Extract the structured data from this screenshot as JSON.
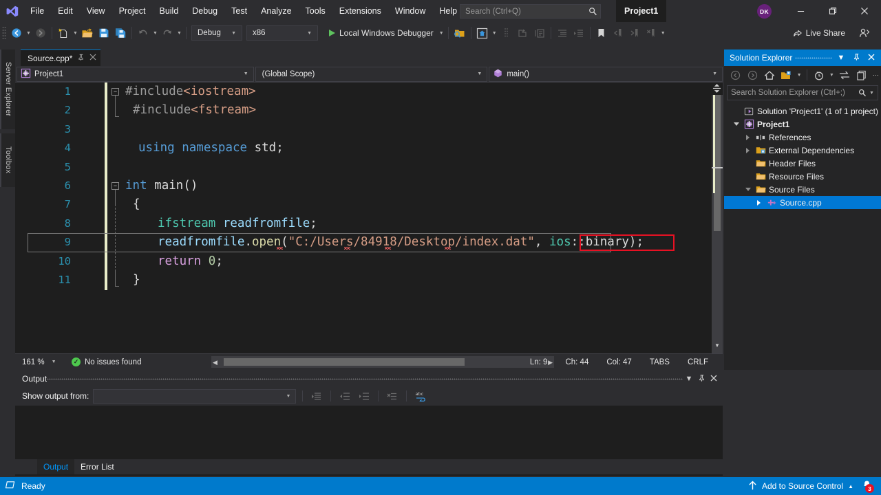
{
  "titlebar": {
    "menu": [
      "File",
      "Edit",
      "View",
      "Project",
      "Build",
      "Debug",
      "Test",
      "Analyze",
      "Tools",
      "Extensions",
      "Window",
      "Help"
    ],
    "search_placeholder": "Search (Ctrl+Q)",
    "search_value": "",
    "project_title": "Project1",
    "avatar_initials": "DK",
    "window_buttons": {
      "minimize": "—",
      "maximize": "❐",
      "close": "✕"
    }
  },
  "toolbar": {
    "config": "Debug",
    "platform": "x86",
    "run_label": "Local Windows Debugger",
    "live_share": "Live Share"
  },
  "vtabs": [
    "Server Explorer",
    "Toolbox"
  ],
  "editor": {
    "tab_label": "Source.cpp*",
    "tab_pin": "‒",
    "tab_close": "✕",
    "nav_project": "Project1",
    "nav_scope": "(Global Scope)",
    "nav_member": "main()",
    "lines": [
      {
        "n": "1",
        "tokens": [
          {
            "t": "#include",
            "c": "pp"
          },
          {
            "t": "<iostream>",
            "c": "inc"
          }
        ]
      },
      {
        "n": "2",
        "tokens": [
          {
            "t": "#include",
            "c": "pp"
          },
          {
            "t": "<fstream>",
            "c": "inc"
          }
        ]
      },
      {
        "n": "3",
        "tokens": []
      },
      {
        "n": "4",
        "tokens": [
          {
            "t": "using",
            "c": "kw"
          },
          {
            "t": " ",
            "c": "plain"
          },
          {
            "t": "namespace",
            "c": "kw"
          },
          {
            "t": " ",
            "c": "plain"
          },
          {
            "t": "std",
            "c": "plain"
          },
          {
            "t": ";",
            "c": "punc"
          }
        ]
      },
      {
        "n": "5",
        "tokens": []
      },
      {
        "n": "6",
        "tokens": [
          {
            "t": "int",
            "c": "kw"
          },
          {
            "t": " ",
            "c": "plain"
          },
          {
            "t": "main",
            "c": "plain"
          },
          {
            "t": "()",
            "c": "punc"
          }
        ]
      },
      {
        "n": "7",
        "tokens": [
          {
            "t": "{",
            "c": "punc"
          }
        ]
      },
      {
        "n": "8",
        "tokens": [
          {
            "t": "ifstream",
            "c": "type"
          },
          {
            "t": " ",
            "c": "plain"
          },
          {
            "t": "readfromfile",
            "c": "ident"
          },
          {
            "t": ";",
            "c": "punc"
          }
        ]
      },
      {
        "n": "9",
        "tokens": [
          {
            "t": "readfromfile",
            "c": "ident"
          },
          {
            "t": ".",
            "c": "punc"
          },
          {
            "t": "open",
            "c": "func"
          },
          {
            "t": "(",
            "c": "punc"
          },
          {
            "t": "\"C:/Users/84918/Desktop/index.dat\"",
            "c": "str"
          },
          {
            "t": ", ",
            "c": "punc"
          },
          {
            "t": "ios",
            "c": "type"
          },
          {
            "t": "::",
            "c": "punc"
          },
          {
            "t": "binary",
            "c": "plain"
          },
          {
            "t": ")",
            "c": "punc"
          },
          {
            "t": ";",
            "c": "punc"
          }
        ]
      },
      {
        "n": "10",
        "tokens": [
          {
            "t": "return",
            "c": "pink"
          },
          {
            "t": " ",
            "c": "plain"
          },
          {
            "t": "0",
            "c": "num"
          },
          {
            "t": ";",
            "c": "punc"
          }
        ]
      },
      {
        "n": "11",
        "tokens": [
          {
            "t": "}",
            "c": "punc"
          }
        ]
      }
    ],
    "highlight_text": "ios::binary",
    "status": {
      "zoom": "161 %",
      "issues": "No issues found",
      "issues_check": "✓",
      "ln": "Ln: 9",
      "ch": "Ch: 44",
      "col": "Col: 47",
      "tabs": "TABS",
      "eol": "CRLF"
    }
  },
  "solution_explorer": {
    "title": "Solution Explorer",
    "header_buttons": {
      "dropdown": "▾",
      "pin": "✕",
      "close": "✕"
    },
    "search_placeholder": "Search Solution Explorer (Ctrl+;)",
    "search_value": "",
    "tree": [
      {
        "label": "Solution 'Project1' (1 of 1 project)",
        "indent": 0,
        "twisty": "none",
        "icon": "solution-icon",
        "bold": false,
        "selected": false
      },
      {
        "label": "Project1",
        "indent": 1,
        "twisty": "expanded",
        "icon": "project-icon",
        "bold": true,
        "selected": false
      },
      {
        "label": "References",
        "indent": 2,
        "twisty": "collapsed",
        "icon": "references-icon",
        "bold": false,
        "selected": false
      },
      {
        "label": "External Dependencies",
        "indent": 2,
        "twisty": "collapsed",
        "icon": "folder-icon",
        "bold": false,
        "selected": false
      },
      {
        "label": "Header Files",
        "indent": 2,
        "twisty": "none",
        "icon": "folder-icon",
        "bold": false,
        "selected": false
      },
      {
        "label": "Resource Files",
        "indent": 2,
        "twisty": "none",
        "icon": "folder-icon",
        "bold": false,
        "selected": false
      },
      {
        "label": "Source Files",
        "indent": 2,
        "twisty": "expanded",
        "icon": "folder-open-icon",
        "bold": false,
        "selected": false
      },
      {
        "label": "Source.cpp",
        "indent": 3,
        "twisty": "collapsed",
        "icon": "cpp-file-icon",
        "bold": false,
        "selected": true
      }
    ]
  },
  "output_panel": {
    "title": "Output",
    "show_output_label": "Show output from:",
    "show_output_value": "",
    "body_text": "",
    "tabs": [
      {
        "label": "Output",
        "active": true
      },
      {
        "label": "Error List",
        "active": false
      }
    ]
  },
  "statusbar": {
    "ready": "Ready",
    "source_control": "Add to Source Control",
    "notification_count": "3"
  },
  "colors": {
    "accent_blue": "#007acc",
    "selection_blue": "#0078d4",
    "chrome": "#2d2d30",
    "editor_bg": "#1e1e1e",
    "panel_bg": "#252526",
    "highlight_red": "#e81123",
    "avatar_purple": "#68217a",
    "change_bar": "#e9edc9",
    "ok_green": "#4ec94e"
  }
}
